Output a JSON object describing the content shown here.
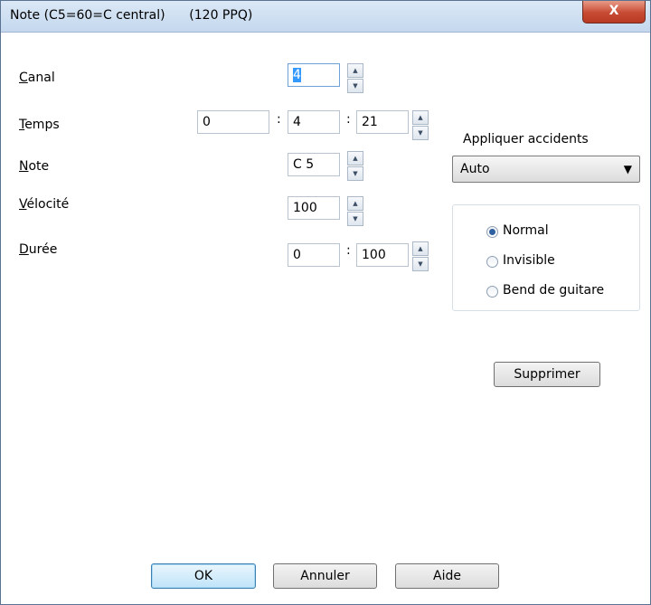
{
  "window": {
    "title": "Note (C5=60=C central)      (120 PPQ)",
    "close_label": "X"
  },
  "fields": {
    "canal": {
      "label_acc": "C",
      "label_rest": "anal",
      "value": "4"
    },
    "temps": {
      "label_acc": "T",
      "label_rest": "emps",
      "values": [
        "0",
        "4",
        "21"
      ]
    },
    "note": {
      "label_acc": "N",
      "label_rest": "ote",
      "value": "C 5"
    },
    "velocite": {
      "label_acc": "V",
      "label_rest": "élocité",
      "value": "100"
    },
    "duree": {
      "label_acc": "D",
      "label_rest": "urée",
      "values": [
        "0",
        "100"
      ]
    }
  },
  "separator": ":",
  "accidents": {
    "label": "Appliquer accidents",
    "selected": "Auto"
  },
  "note_type": {
    "options": [
      "Normal",
      "Invisible",
      "Bend de guitare"
    ],
    "selected_index": 0
  },
  "buttons": {
    "supprimer": "Supprimer",
    "ok": "OK",
    "annuler": "Annuler",
    "aide": "Aide"
  }
}
